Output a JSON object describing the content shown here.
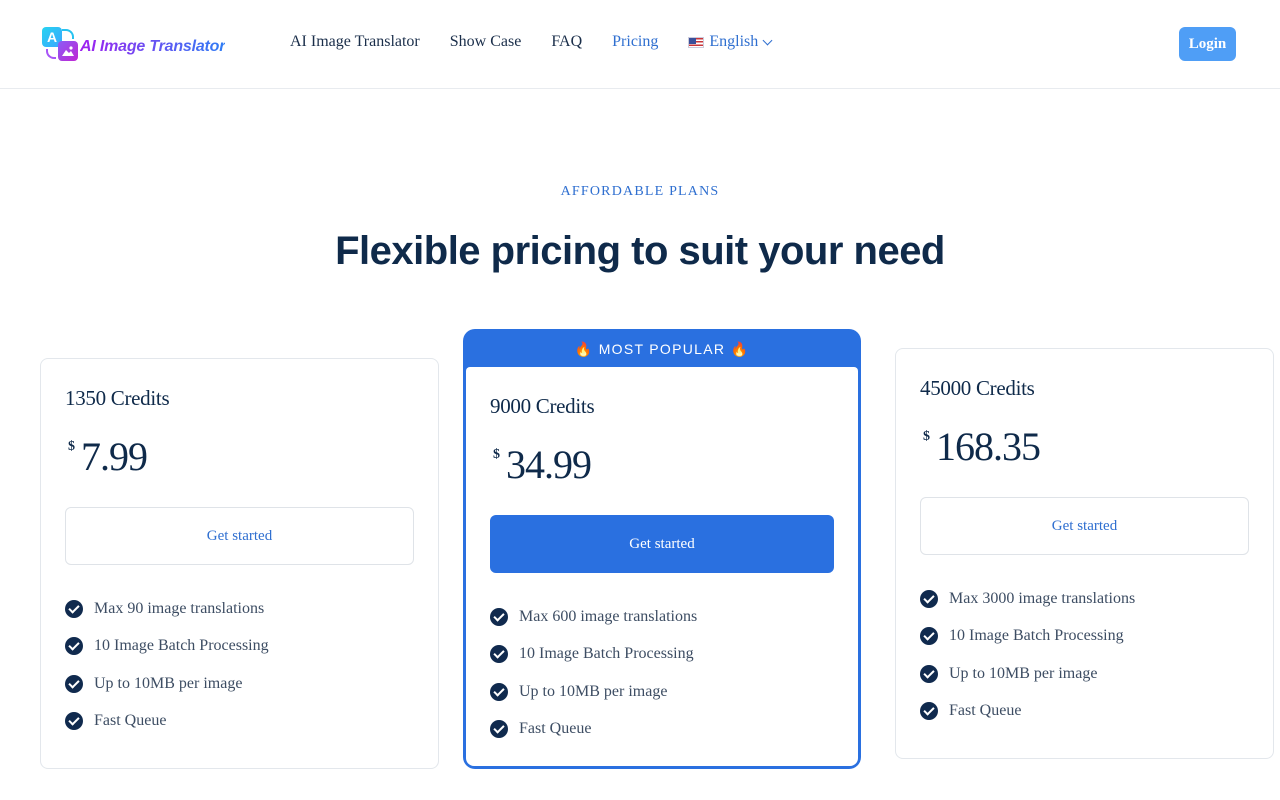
{
  "header": {
    "logo_letter": "A",
    "logo_text": "AI Image Translator",
    "nav": [
      "AI Image Translator",
      "Show Case",
      "FAQ",
      "Pricing"
    ],
    "active_nav": "Pricing",
    "language": "English",
    "login_label": "Login"
  },
  "section": {
    "eyebrow": "AFFORDABLE PLANS",
    "title": "Flexible pricing to suit your need"
  },
  "popular_badge": "🔥 MOST POPULAR 🔥",
  "plans": [
    {
      "title": "1350 Credits",
      "currency": "$",
      "price": "7.99",
      "cta": "Get started",
      "features": [
        "Max 90 image translations",
        "10 Image Batch Processing",
        "Up to 10MB per image",
        "Fast Queue"
      ]
    },
    {
      "title": "9000 Credits",
      "currency": "$",
      "price": "34.99",
      "cta": "Get started",
      "features": [
        "Max 600 image translations",
        "10 Image Batch Processing",
        "Up to 10MB per image",
        "Fast Queue"
      ]
    },
    {
      "title": "45000 Credits",
      "currency": "$",
      "price": "168.35",
      "cta": "Get started",
      "features": [
        "Max 3000 image translations",
        "10 Image Batch Processing",
        "Up to 10MB per image",
        "Fast Queue"
      ]
    }
  ],
  "colors": {
    "accent": "#2a70e0",
    "link": "#2f6fd0",
    "login_bg": "#4f9ef6",
    "heading": "#0f2a4a"
  }
}
